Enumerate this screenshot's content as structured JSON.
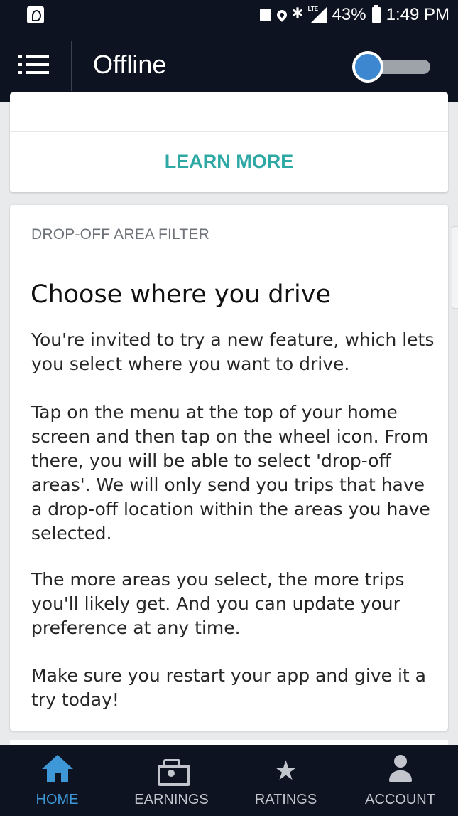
{
  "status_bar": {
    "lte": "LTE",
    "battery": "43%",
    "time": "1:49 PM"
  },
  "app_bar": {
    "title": "Offline",
    "toggle_on": false
  },
  "top_card": {
    "link": "LEARN MORE"
  },
  "feature_card": {
    "kicker": "DROP-OFF AREA FILTER",
    "headline": "Choose where you drive",
    "paragraphs": [
      "You're invited to try a new feature, which lets you select where you want to drive.",
      "Tap on the menu at the top of your home screen and then tap on the wheel icon. From there, you will be able to select 'drop-off areas'. We will only send you trips that have a drop-off location within the areas you have selected.",
      "The more areas you select, the more trips you'll likely get. And you can update your preference at any time.",
      "Make sure you restart your app and give it a try today!"
    ]
  },
  "bottom_nav": {
    "items": [
      {
        "label": "HOME",
        "icon": "home-icon",
        "active": true
      },
      {
        "label": "EARNINGS",
        "icon": "earnings-icon",
        "active": false
      },
      {
        "label": "RATINGS",
        "icon": "star-icon",
        "active": false
      },
      {
        "label": "ACCOUNT",
        "icon": "person-icon",
        "active": false
      }
    ]
  },
  "colors": {
    "bar_background": "#0d1320",
    "accent_teal": "#2ea8a5",
    "active_blue": "#3e98d8",
    "toggle_knob": "#3d87d1"
  }
}
